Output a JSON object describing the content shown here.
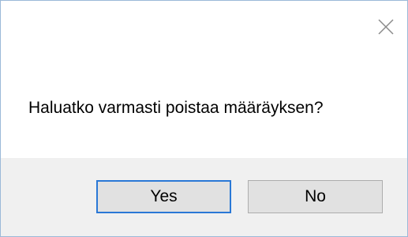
{
  "dialog": {
    "message": "Haluatko varmasti poistaa määräyksen?",
    "buttons": {
      "yes_label": "Yes",
      "no_label": "No"
    },
    "icons": {
      "close": "close-icon"
    },
    "colors": {
      "footer_background": "#f0f0f0",
      "default_button_border": "#2a78d6",
      "button_background": "#e1e1e1"
    }
  }
}
